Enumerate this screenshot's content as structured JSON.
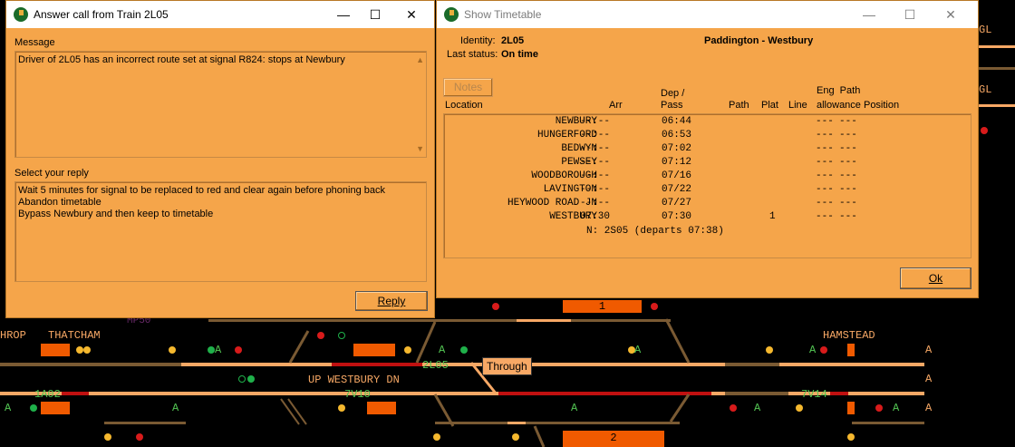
{
  "diagram": {
    "labels": [
      "HROP",
      "THATCHAM",
      "HAMSTEAD",
      "UP WESTBURY DN",
      "MP50"
    ],
    "descriptions": [
      "2L05",
      "1A02",
      "7V10",
      "7V14"
    ],
    "platforms": [
      "1",
      "2"
    ],
    "gl_labels": [
      "GL",
      "GL"
    ],
    "a_markers": [
      "A",
      "A",
      "A"
    ],
    "through_tooltip": "Through",
    "signal_letters": [
      "A",
      "A",
      "A",
      "A",
      "A",
      "A",
      "A",
      "A",
      "A"
    ]
  },
  "answer_window": {
    "title": "Answer call from Train 2L05",
    "message_label": "Message",
    "message_text": "Driver of 2L05 has an incorrect route set at signal R824: stops at Newbury",
    "reply_label": "Select your reply",
    "replies": [
      "Wait 5 minutes for signal to be replaced to red and clear again before phoning back",
      "Abandon timetable",
      "Bypass Newbury and then keep to timetable"
    ],
    "reply_button": "Reply",
    "controls": {
      "minimize": "—",
      "maximize": "☐",
      "close": "✕"
    }
  },
  "timetable_window": {
    "title": "Show Timetable",
    "identity_label": "Identity:",
    "identity_value": "2L05",
    "status_label": "Last status:",
    "status_value": "On time",
    "route": "Paddington - Westbury",
    "notes_button": "Notes",
    "ok_button": "Ok",
    "headers": {
      "location": "Location",
      "arr": "Arr",
      "dep_pass": "Dep /\nPass",
      "path": "Path",
      "plat": "Plat",
      "line": "Line",
      "eng_path_top": "Eng  Path",
      "allowance_position": "allowance Position"
    },
    "rows": [
      {
        "location": "NEWBURY",
        "arr": "--:--",
        "dep": "06:44",
        "plat": "",
        "allow": "---",
        "pos": "---"
      },
      {
        "location": "HUNGERFORD",
        "arr": "--:--",
        "dep": "06:53",
        "plat": "",
        "allow": "---",
        "pos": "---"
      },
      {
        "location": "BEDWYN",
        "arr": "--:--",
        "dep": "07:02",
        "plat": "",
        "allow": "---",
        "pos": "---"
      },
      {
        "location": "PEWSEY",
        "arr": "--:--",
        "dep": "07:12",
        "plat": "",
        "allow": "---",
        "pos": "---"
      },
      {
        "location": "WOODBOROUGH",
        "arr": "--:--",
        "dep": "07/16",
        "plat": "",
        "allow": "---",
        "pos": "---"
      },
      {
        "location": "LAVINGTON",
        "arr": "--:--",
        "dep": "07/22",
        "plat": "",
        "allow": "---",
        "pos": "---"
      },
      {
        "location": "HEYWOOD ROAD JN",
        "arr": "--:--",
        "dep": "07/27",
        "plat": "",
        "allow": "---",
        "pos": "---"
      },
      {
        "location": "WESTBURY",
        "arr": "07:30",
        "dep": "07:30",
        "plat": "1",
        "allow": "---",
        "pos": "---"
      }
    ],
    "next_service": "N: 2S05 (departs 07:38)",
    "controls": {
      "minimize": "—",
      "maximize": "☐",
      "close": "✕"
    }
  }
}
